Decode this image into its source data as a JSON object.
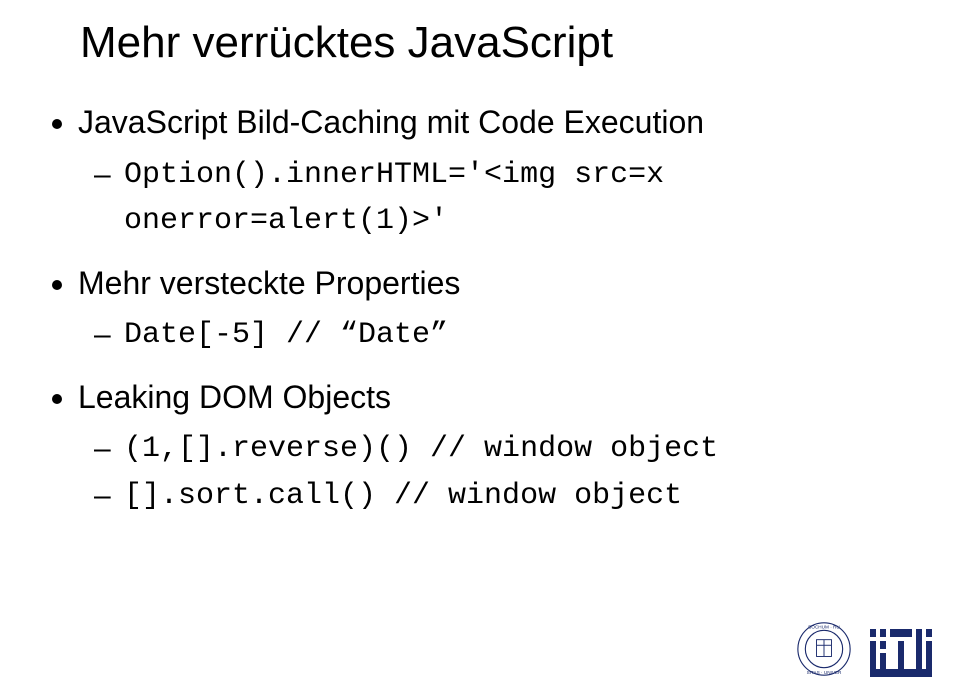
{
  "title": "Mehr verrücktes JavaScript",
  "bullets": {
    "b1": {
      "text": "JavaScript Bild-Caching mit Code Execution",
      "sub1": "Option().innerHTML='<img src=x onerror=alert(1)>'"
    },
    "b2": {
      "text": "Mehr versteckte Properties",
      "sub1": "Date[-5] // “Date”"
    },
    "b3": {
      "text": "Leaking DOM Objects",
      "sub1": "(1,[].reverse)() // window object",
      "sub2": "[].sort.call() // window object"
    }
  }
}
